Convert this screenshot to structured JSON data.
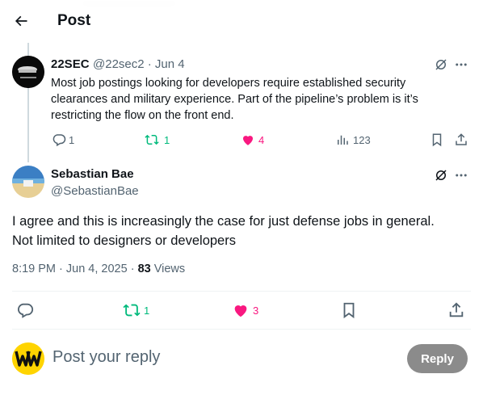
{
  "header": {
    "title": "Post"
  },
  "parent_post": {
    "author_name": "22SEC",
    "handle_date": "@22sec2 · Jun 4",
    "text_line1": "Most job postings looking for developers require established security",
    "text_line2": "clearances and military experience. Part of the pipeline’s problem is it’s",
    "text_line3": "restricting the flow on the front end.",
    "replies": "1",
    "reposts": "1",
    "likes": "4",
    "views": "123"
  },
  "main_post": {
    "author_name": "Sebastian Bae",
    "handle": "@SebastianBae",
    "text_line1": "I agree and this is increasingly the case for just defense jobs in general.",
    "text_line2": "Not limited to designers or developers",
    "timestamp": "8:19 PM · Jun 4, 2025 · ",
    "views_count": "83",
    "views_label": " Views",
    "reposts": "1",
    "likes": "3"
  },
  "reply_box": {
    "placeholder": "Post your reply",
    "button_label": "Reply"
  },
  "colors": {
    "text_primary": "#0f1419",
    "text_secondary": "#536471",
    "repost_green": "#00ba7c",
    "like_pink": "#f91880",
    "divider": "#eff3f4"
  }
}
